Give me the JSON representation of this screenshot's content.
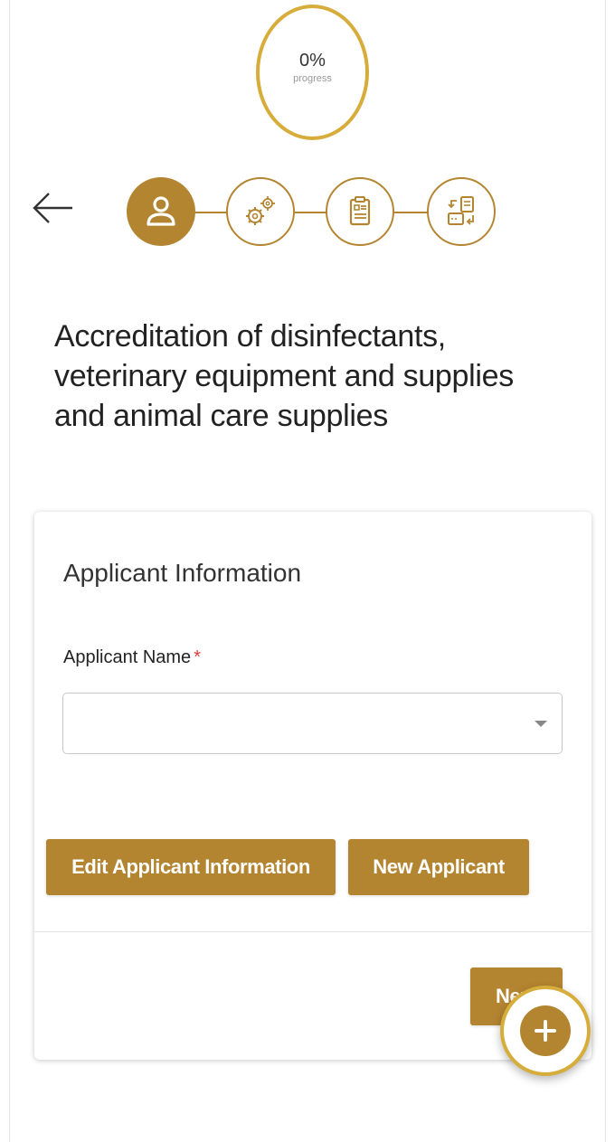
{
  "progress": {
    "value": "0%",
    "label": "progress",
    "percent": 0
  },
  "navigation": {
    "back_icon": "arrow-left-icon"
  },
  "steps": [
    {
      "icon": "user-icon",
      "state": "active"
    },
    {
      "icon": "gears-icon",
      "state": "inactive"
    },
    {
      "icon": "clipboard-icon",
      "state": "inactive"
    },
    {
      "icon": "document-exchange-icon",
      "state": "inactive"
    }
  ],
  "page": {
    "title": "Accreditation of disinfectants, veterinary equipment and supplies and animal care supplies"
  },
  "form": {
    "section_title": "Applicant Information",
    "applicant_name_label": "Applicant Name",
    "required_marker": "*",
    "applicant_name_value": "",
    "edit_button": "Edit Applicant Information",
    "new_button": "New Applicant",
    "next_button": "Next"
  },
  "fab": {
    "icon": "plus-icon"
  },
  "colors": {
    "accent": "#b48530",
    "accent_light": "#d6ad3b",
    "required": "#e53935"
  }
}
